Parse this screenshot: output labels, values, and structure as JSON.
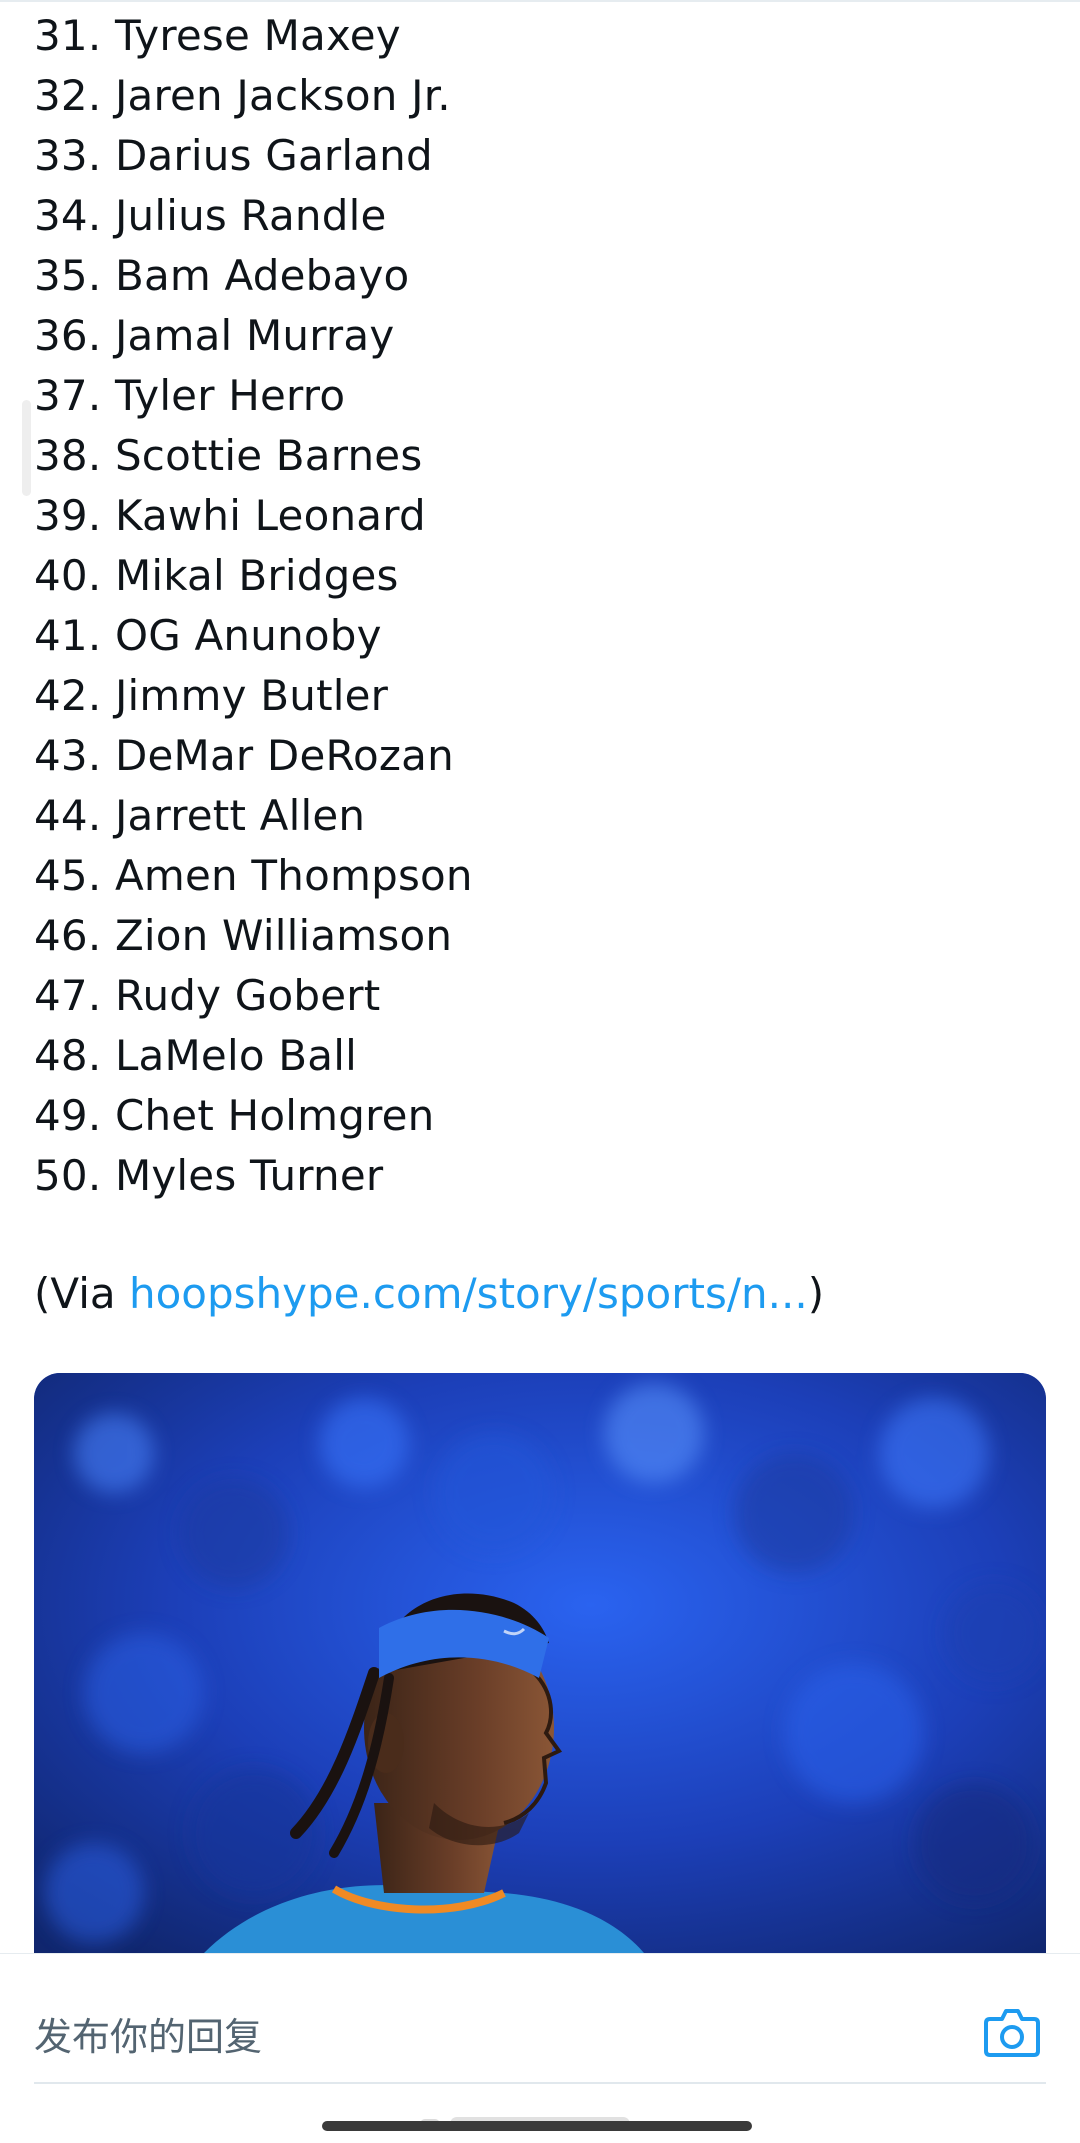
{
  "ranking": {
    "items": [
      "31. Tyrese Maxey",
      "32. Jaren Jackson Jr.",
      "33. Darius Garland",
      "34. Julius Randle",
      "35. Bam Adebayo",
      "36. Jamal Murray",
      "37. Tyler Herro",
      "38. Scottie Barnes",
      "39. Kawhi Leonard",
      "40. Mikal Bridges",
      "41. OG Anunoby",
      "42. Jimmy Butler",
      "43. DeMar DeRozan",
      "44. Jarrett Allen",
      "45. Amen Thompson",
      "46. Zion Williamson",
      "47. Rudy Gobert",
      "48. LaMelo Ball",
      "49. Chet Holmgren",
      "50. Myles Turner"
    ]
  },
  "source": {
    "prefix": "(Via ",
    "link": "hoopshype.com/story/sports/n...",
    "suffix": ")"
  },
  "media": {
    "alt": "",
    "background_color": "#1a3fbf"
  },
  "reply": {
    "placeholder": "发布你的回复",
    "camera_icon": "camera-icon"
  },
  "colors": {
    "link": "#1d9bf0",
    "text": "#0f1419",
    "muted": "#536471"
  }
}
